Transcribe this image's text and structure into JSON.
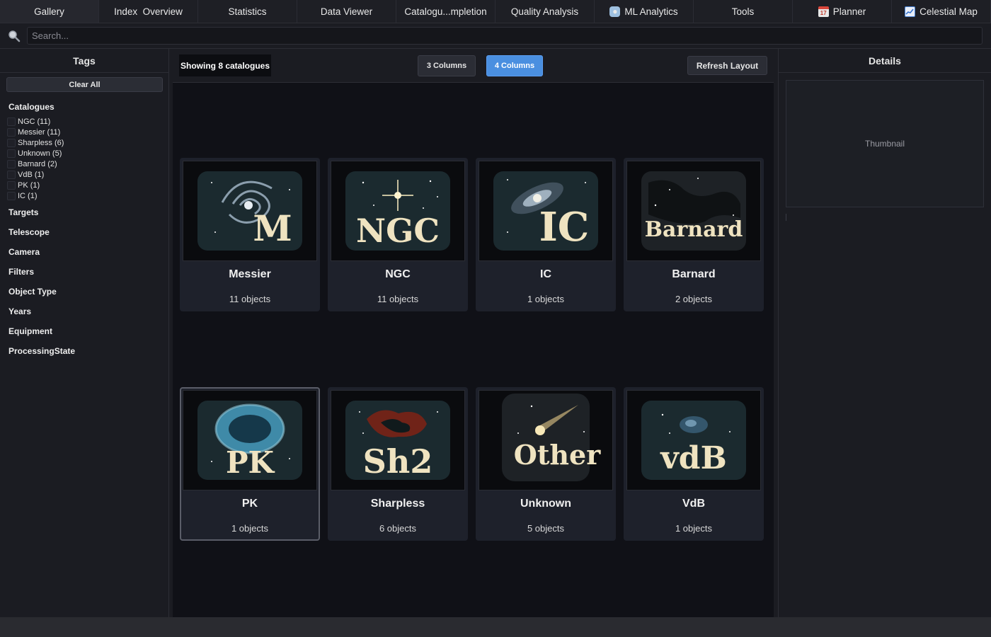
{
  "tabs": [
    {
      "label": "Gallery",
      "icon": "",
      "active": true
    },
    {
      "label": "Index  Overview",
      "icon": ""
    },
    {
      "label": "Statistics",
      "icon": ""
    },
    {
      "label": "Data Viewer",
      "icon": ""
    },
    {
      "label": "Catalogu...mpletion",
      "icon": ""
    },
    {
      "label": "Quality Analysis",
      "icon": ""
    },
    {
      "label": "ML Analytics",
      "icon": "robot-icon"
    },
    {
      "label": "Tools",
      "icon": ""
    },
    {
      "label": "Planner",
      "icon": "calendar-icon"
    },
    {
      "label": "Celestial Map",
      "icon": "chart-icon"
    }
  ],
  "search": {
    "placeholder": "Search..."
  },
  "sidebar": {
    "title": "Tags",
    "clear_label": "Clear All",
    "catalogues_title": "Catalogues",
    "catalogues": [
      "NGC (11)",
      "Messier (11)",
      "Sharpless (6)",
      "Unknown (5)",
      "Barnard (2)",
      "VdB (1)",
      "PK (1)",
      "IC (1)"
    ],
    "groups": [
      "Targets",
      "Telescope",
      "Camera",
      "Filters",
      "Object Type",
      "Years",
      "Equipment",
      "ProcessingState"
    ]
  },
  "toolbar": {
    "showing": "Showing 8 catalogues",
    "btn3": "3 Columns",
    "btn4": "4 Columns",
    "refresh": "Refresh Layout"
  },
  "cards": [
    {
      "name": "Messier",
      "count": "11 objects",
      "logo": "M",
      "art": "spiral"
    },
    {
      "name": "NGC",
      "count": "11 objects",
      "logo": "NGC",
      "art": "star"
    },
    {
      "name": "IC",
      "count": "1 objects",
      "logo": "IC",
      "art": "galaxy"
    },
    {
      "name": "Barnard",
      "count": "2 objects",
      "logo": "Barnard",
      "art": "darkcloud"
    },
    {
      "name": "PK",
      "count": "1 objects",
      "logo": "PK",
      "art": "planetary",
      "selected": true
    },
    {
      "name": "Sharpless",
      "count": "6 objects",
      "logo": "Sh2",
      "art": "redneb"
    },
    {
      "name": "Unknown",
      "count": "5 objects",
      "logo": "Other",
      "art": "comet"
    },
    {
      "name": "VdB",
      "count": "1 objects",
      "logo": "vdB",
      "art": "blueneb"
    }
  ],
  "details": {
    "title": "Details",
    "thumbnail_label": "Thumbnail"
  },
  "colors": {
    "accent": "#4a8fe0",
    "logo_text": "#efe3c0"
  }
}
